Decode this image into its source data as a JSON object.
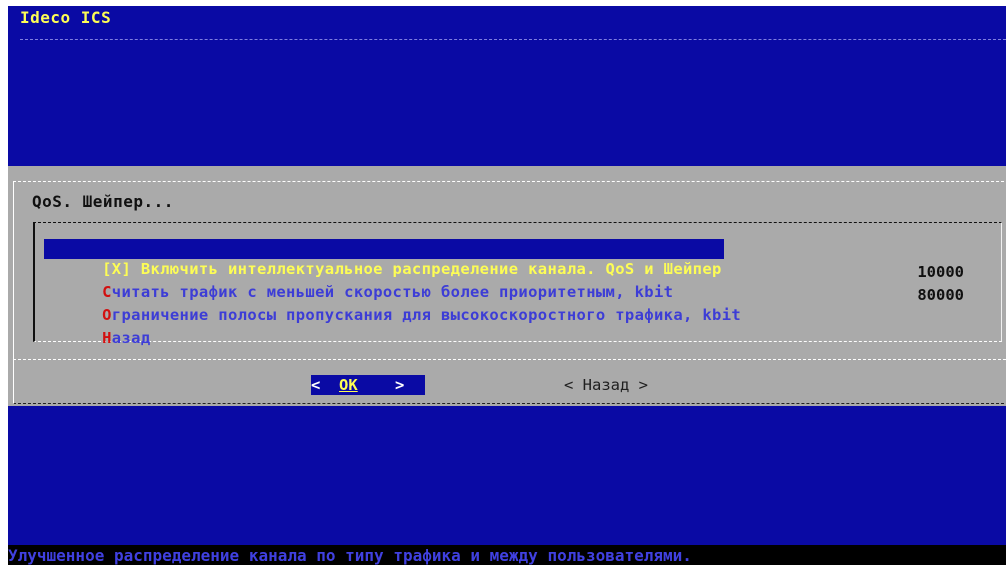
{
  "app": {
    "title": "Ideco ICS"
  },
  "dialog": {
    "title": "QoS. Шейпер...",
    "menu": [
      {
        "hotkey": "[X]",
        "label": " Включить интеллектуальное распределение канала. QoS и Шейпер",
        "value": "",
        "selected": true
      },
      {
        "hotkey": "С",
        "label": "читать трафик с меньшей скоростью более приоритетным, kbit",
        "value": "10000",
        "selected": false
      },
      {
        "hotkey": "О",
        "label": "граничение полосы пропускания для высокоскоростного трафика, kbit",
        "value": "80000",
        "selected": false
      },
      {
        "hotkey": "Н",
        "label": "азад",
        "value": "",
        "selected": false
      }
    ],
    "buttons": {
      "ok": {
        "left": "<",
        "label": "OK",
        "right": ">"
      },
      "back": {
        "text": "< Назад >"
      }
    }
  },
  "status": {
    "text": "Улучшенное распределение канала по типу трафика и между пользователями."
  },
  "colors": {
    "screen_bg": "#0a0aa4",
    "dialog_bg": "#aaaaaa",
    "highlight_fg": "#fdfd55",
    "hotkey": "#d21010",
    "item_fg": "#3d3dd6"
  }
}
